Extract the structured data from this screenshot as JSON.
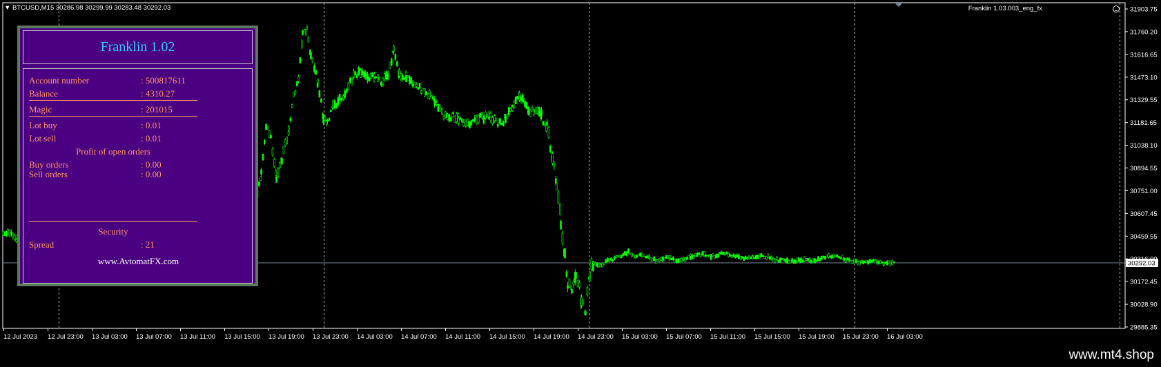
{
  "chart": {
    "symbol": "BTCUSD,M15",
    "ohlc": "30286.98 30299.99 30283.48 30292.03",
    "ea_label": "Franklin 1.03.003_eng_fx",
    "current_price": "30292.03",
    "price_levels": [
      "31903.75",
      "31760.20",
      "31616.65",
      "31473.10",
      "31329.55",
      "31181.65",
      "31038.10",
      "30894.55",
      "30751.00",
      "30607.45",
      "30459.55",
      "30316.00",
      "30172.45",
      "30028.90",
      "29885.35"
    ],
    "time_labels": [
      "12 Jul 2023",
      "12 Jul 23:00",
      "13 Jul 03:00",
      "13 Jul 07:00",
      "13 Jul 11:00",
      "13 Jul 15:00",
      "13 Jul 19:00",
      "13 Jul 23:00",
      "14 Jul 03:00",
      "14 Jul 07:00",
      "14 Jul 11:00",
      "14 Jul 15:00",
      "14 Jul 19:00",
      "14 Jul 23:00",
      "15 Jul 03:00",
      "15 Jul 07:00",
      "15 Jul 11:00",
      "15 Jul 15:00",
      "15 Jul 19:00",
      "15 Jul 23:00",
      "16 Jul 03:00"
    ],
    "colors": {
      "bg": "#000000",
      "candle": "#00ff00",
      "grid": "#c0c0c0",
      "bid_line": "#778899",
      "text": "#ffffff"
    }
  },
  "panel": {
    "title": "Franklin 1.02",
    "rows": [
      {
        "label": "Account number",
        "value": ": 500817611"
      },
      {
        "label": "Balance",
        "value": ": 4310.27"
      },
      {
        "label": "Magic",
        "value": ": 201015"
      },
      {
        "label": "Lot buy",
        "value": ": 0.01"
      },
      {
        "label": "Lot sell",
        "value": ": 0.01"
      },
      {
        "label": "Buy orders",
        "value": ": 0.00"
      },
      {
        "label": "Sell orders",
        "value": ": 0.00"
      },
      {
        "label": "Spread",
        "value": ": 21"
      }
    ],
    "profit_title": "Profit of open orders",
    "security_title": "Security",
    "website": "www.AvtomatFX.com",
    "colors": {
      "bg": "#4a0080",
      "title": "#33ccff",
      "text": "#ff9966",
      "border": "#5b7a5b"
    }
  },
  "footer": {
    "watermark": "www.mt4.shop"
  }
}
